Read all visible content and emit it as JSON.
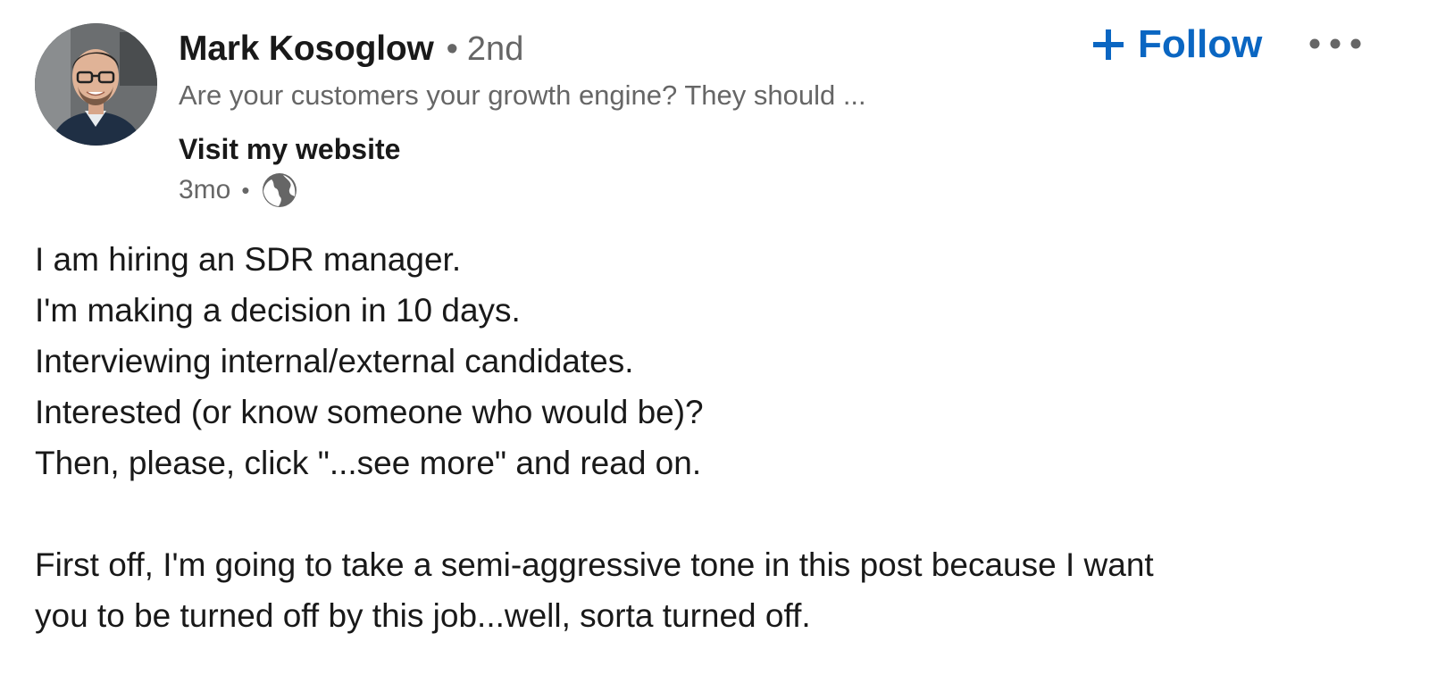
{
  "author": {
    "name": "Mark Kosoglow",
    "degree": "2nd",
    "degree_separator": "•",
    "headline": "Are your customers your growth engine? They should ...",
    "website_label": "Visit my website",
    "avatar_icon": "profile-photo"
  },
  "meta": {
    "timestamp": "3mo",
    "separator": "•",
    "visibility_icon": "globe-icon"
  },
  "actions": {
    "follow_label": "Follow",
    "follow_icon": "plus-icon",
    "more_icon": "ellipsis-icon"
  },
  "post": {
    "lines": [
      "I am hiring an SDR manager.",
      "I'm making a decision in 10 days.",
      "Interviewing internal/external candidates.",
      "Interested (or know someone who would be)?",
      "Then, please, click \"...see more\" and read on."
    ],
    "paragraph2": [
      "First off, I'm going to take a semi-aggressive tone in this post because I want",
      "you to be turned off by this job...well, sorta turned off."
    ]
  },
  "colors": {
    "accent": "#0a66c2",
    "text_primary": "#191919",
    "text_secondary": "#666666"
  }
}
